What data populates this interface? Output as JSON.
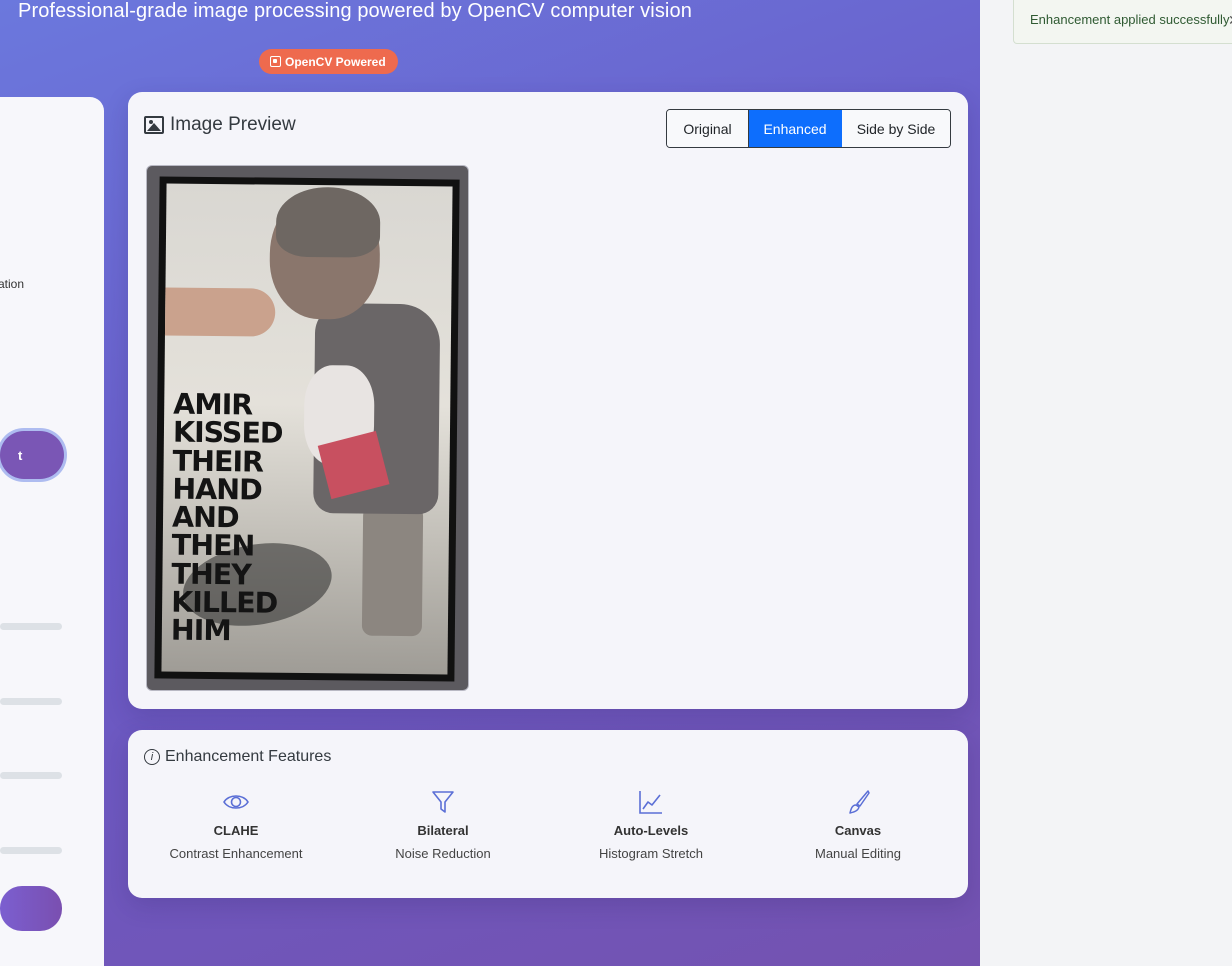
{
  "header": {
    "subtitle": "Professional-grade image processing powered by OpenCV computer vision",
    "badge": "OpenCV Powered"
  },
  "sidebar": {
    "partial_text": "ation",
    "button_partial": "t"
  },
  "preview": {
    "title": "Image Preview",
    "view_modes": [
      "Original",
      "Enhanced",
      "Side by Side"
    ],
    "active_mode": "Enhanced",
    "image_caption": "AMIR\nKISSED\nTHEIR\nHAND\nAND\nTHEN\nTHEY\nKILLED\nHIM"
  },
  "features": {
    "title": "Enhancement Features",
    "items": [
      {
        "name": "CLAHE",
        "desc": "Contrast Enhancement",
        "icon": "eye-icon"
      },
      {
        "name": "Bilateral",
        "desc": "Noise Reduction",
        "icon": "filter-icon"
      },
      {
        "name": "Auto-Levels",
        "desc": "Histogram Stretch",
        "icon": "graph-up-icon"
      },
      {
        "name": "Canvas",
        "desc": "Manual Editing",
        "icon": "brush-icon"
      }
    ]
  },
  "toast": {
    "message": "Enhancement applied successfully"
  },
  "colors": {
    "accent": "#0d6efd",
    "badge": "#ee6a4e",
    "icon": "#5b6fd6",
    "success_text": "#2f5a32"
  }
}
